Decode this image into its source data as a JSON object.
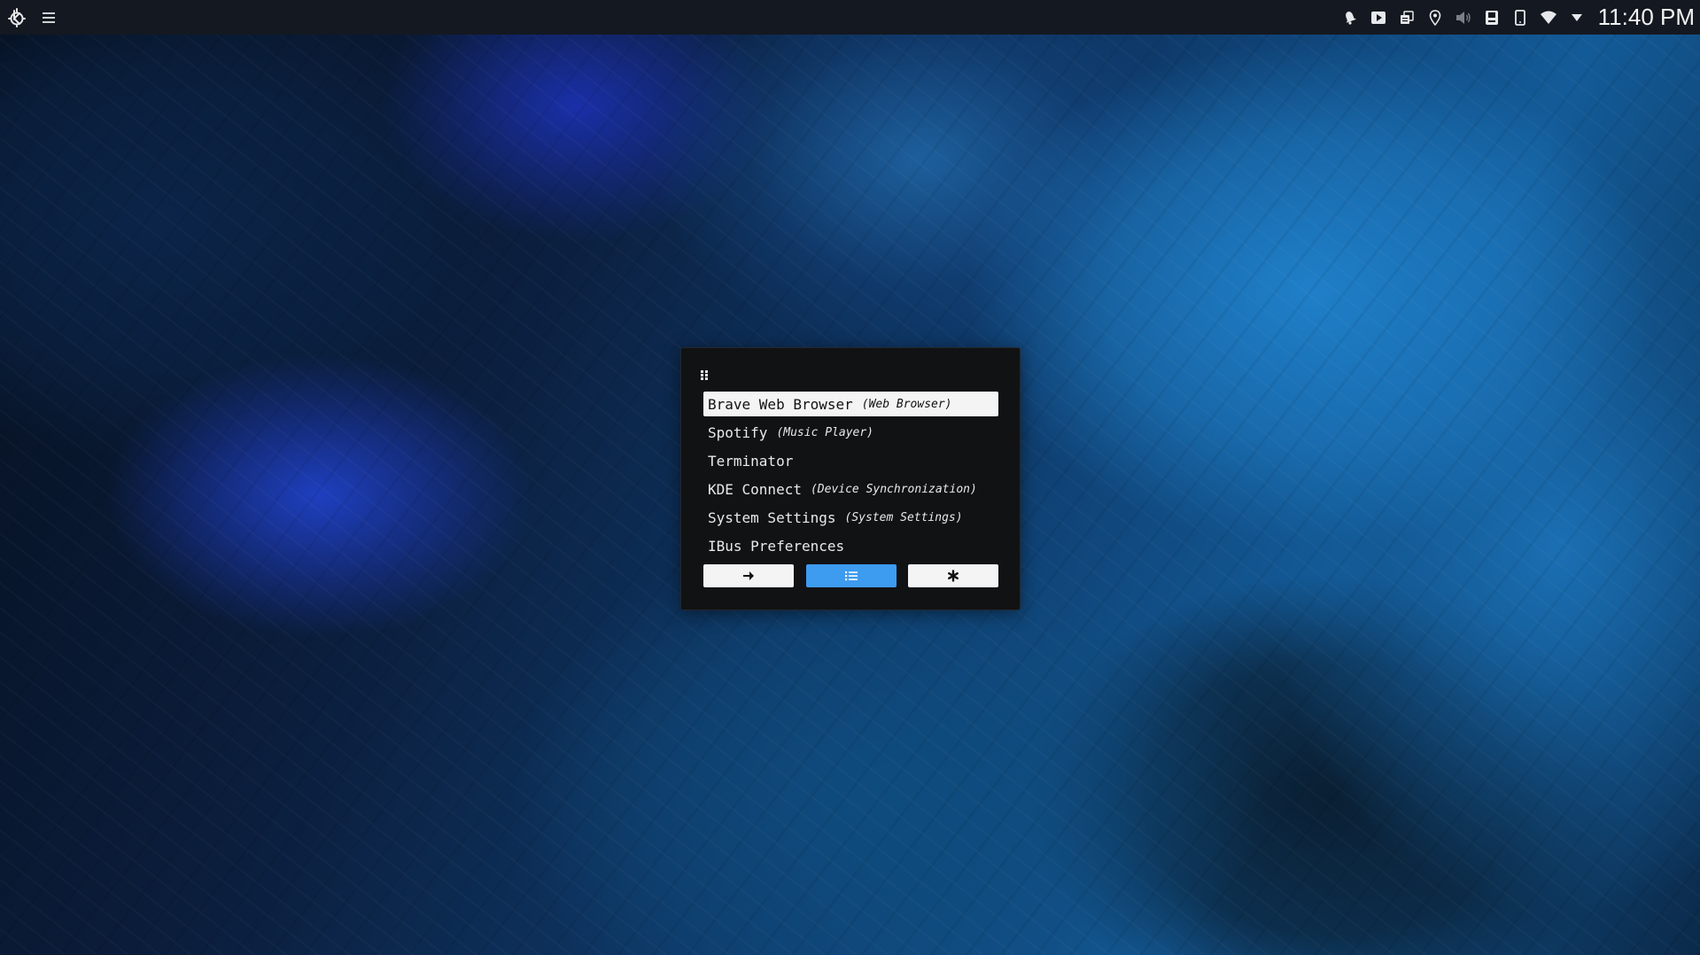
{
  "panel": {
    "left_icons": [
      "kde-logo-icon",
      "hamburger-menu-icon"
    ],
    "tray_icons": [
      "notifications-bell-icon",
      "media-player-icon",
      "clipboard-icon",
      "location-pin-icon",
      "volume-muted-icon",
      "storage-device-icon",
      "phone-device-icon",
      "wifi-icon",
      "expand-tray-arrow-icon"
    ],
    "clock": "11:40 PM"
  },
  "launcher": {
    "entries": [
      {
        "name": "Brave Web Browser",
        "comment": "(Web Browser)",
        "selected": true
      },
      {
        "name": "Spotify",
        "comment": "(Music Player)",
        "selected": false
      },
      {
        "name": "Terminator",
        "comment": "",
        "selected": false
      },
      {
        "name": "KDE Connect",
        "comment": "(Device Synchronization)",
        "selected": false
      },
      {
        "name": "System Settings",
        "comment": "(System Settings)",
        "selected": false
      },
      {
        "name": "IBus Preferences",
        "comment": "",
        "selected": false
      }
    ],
    "mode_buttons": [
      {
        "icon": "arrow-right-icon",
        "mode": "run",
        "active": false
      },
      {
        "icon": "list-icon",
        "mode": "drun",
        "active": true
      },
      {
        "icon": "asterisk-icon",
        "mode": "window",
        "active": false
      }
    ]
  },
  "colors": {
    "panel_bg": "#141820",
    "launcher_bg": "#111214",
    "selected_bg": "#f4f4f5",
    "accent": "#3d9bf0"
  }
}
